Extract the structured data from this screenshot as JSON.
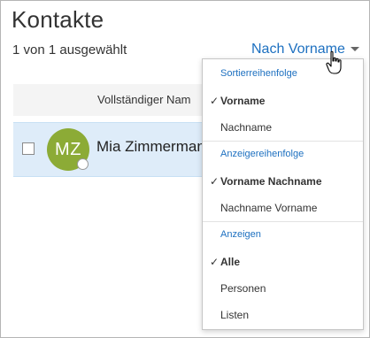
{
  "header": {
    "title": "Kontakte",
    "selection_count": "1 von 1 ausgewählt",
    "sort_label": "Nach Vorname"
  },
  "list": {
    "column_header": "Vollständiger Nam",
    "contacts": [
      {
        "initials": "MZ",
        "name": "Mia Zimmerman",
        "avatar_color": "#8cab36",
        "selected": true
      }
    ]
  },
  "sort_menu": {
    "sections": [
      {
        "label": "Sortierreihenfolge",
        "items": [
          {
            "label": "Vorname",
            "checked": true
          },
          {
            "label": "Nachname",
            "checked": false
          }
        ]
      },
      {
        "label": "Anzeigereihenfolge",
        "items": [
          {
            "label": "Vorname Nachname",
            "checked": true
          },
          {
            "label": "Nachname Vorname",
            "checked": false
          }
        ]
      },
      {
        "label": "Anzeigen",
        "items": [
          {
            "label": "Alle",
            "checked": true
          },
          {
            "label": "Personen",
            "checked": false
          },
          {
            "label": "Listen",
            "checked": false
          }
        ]
      }
    ]
  },
  "colors": {
    "accent": "#1d70c0",
    "selection_background": "#deecf9",
    "header_background": "#f4f4f4"
  },
  "icons": {
    "checkmark": "✓",
    "caret": "chevron-down-icon",
    "cursor": "hand-pointer-icon"
  }
}
